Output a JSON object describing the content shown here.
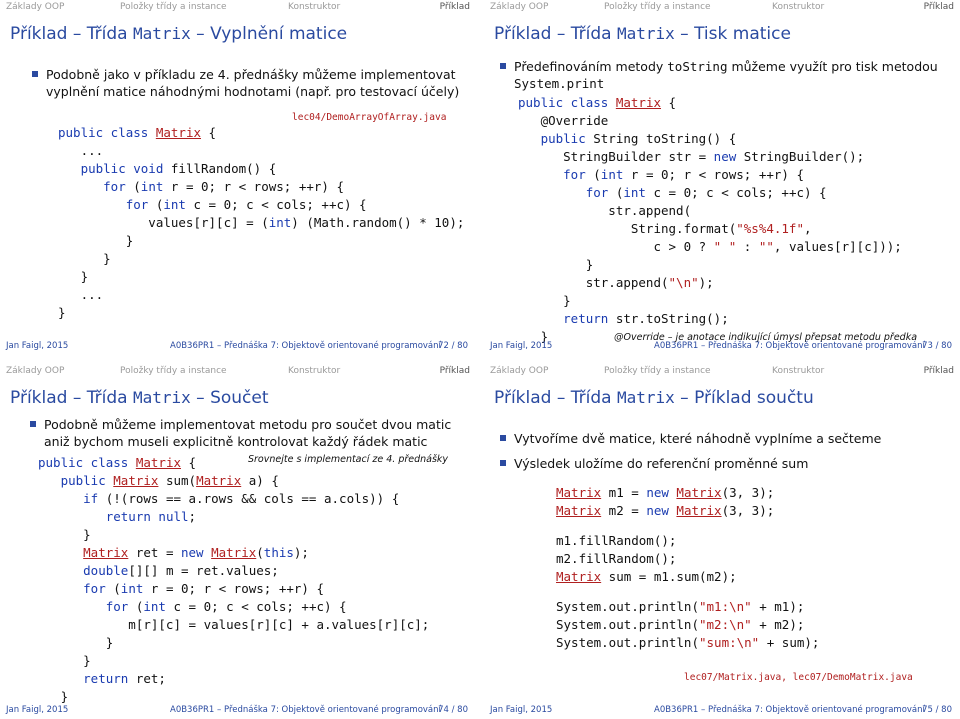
{
  "nav": {
    "n1": "Základy OOP",
    "n2": "Položky třídy a instance",
    "n3": "Konstruktor",
    "n4": "Příklad"
  },
  "footer": {
    "author": "Jan Faigl, 2015",
    "course": "A0B36PR1 – Přednáška 7: Objektově orientované programování"
  },
  "slides": {
    "s72": {
      "title_pre": "Příklad – Třída ",
      "title_mono": "Matrix",
      "title_post": " – Vyplnění matice",
      "bullet": "Podobně jako v příkladu ze 4. přednášky můžeme implementovat vyplnění matice náhodnými hodnotami (např. pro testovací účely)",
      "file": "lec04/DemoArrayOfArray.java",
      "page": "72 / 80"
    },
    "s73": {
      "title_pre": "Příklad – Třída ",
      "title_mono": "Matrix",
      "title_post": " – Tisk matice",
      "bullet_pre": "Předefinováním metody ",
      "bullet_mono1": "toString",
      "bullet_mid": " můžeme využít pro tisk metodou ",
      "bullet_mono2": "System.print",
      "note": "@Override – je anotace indikující úmysl přepsat metodu předka",
      "page": "73 / 80"
    },
    "s74": {
      "title_pre": "Příklad – Třída ",
      "title_mono": "Matrix",
      "title_post": " – Součet",
      "bullet": "Podobně můžeme implementovat metodu pro součet dvou matic aniž bychom museli explicitně kontrolovat každý řádek matic",
      "note": "Srovnejte s implementací ze 4. přednášky",
      "page": "74 / 80"
    },
    "s75": {
      "title_pre": "Příklad – Třída ",
      "title_mono": "Matrix",
      "title_post": " – Příklad součtu",
      "bullet1": "Vytvoříme dvě matice, které náhodně vyplníme a sečteme",
      "bullet2": "Výsledek uložíme do referenční proměnné sum",
      "files": "lec07/Matrix.java, lec07/DemoMatrix.java",
      "page": "75 / 80"
    }
  }
}
